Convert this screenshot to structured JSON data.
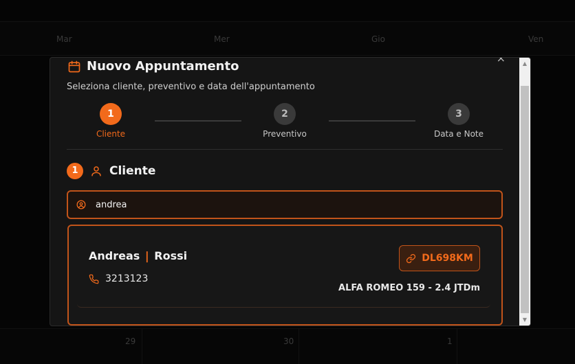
{
  "calendar": {
    "days": [
      "Mar",
      "Mer",
      "Gio",
      "Ven"
    ],
    "dates": [
      "29",
      "30",
      "1"
    ]
  },
  "modal": {
    "title": "Nuovo Appuntamento",
    "subtitle": "Seleziona cliente, preventivo e data dell'appuntamento",
    "close_label": "×",
    "steps": [
      {
        "number": "1",
        "label": "Cliente"
      },
      {
        "number": "2",
        "label": "Preventivo"
      },
      {
        "number": "3",
        "label": "Data e Note"
      }
    ],
    "section": {
      "number": "1",
      "title": "Cliente"
    },
    "search": {
      "value": "andrea"
    },
    "result": {
      "first_name": "Andreas",
      "separator": "|",
      "last_name": "Rossi",
      "phone": "3213123",
      "plate": "DL698KM",
      "vehicle": "ALFA ROMEO 159 - 2.4 JTDm"
    }
  },
  "colors": {
    "accent": "#f26a1b",
    "background": "#050505",
    "modal": "#151515"
  }
}
